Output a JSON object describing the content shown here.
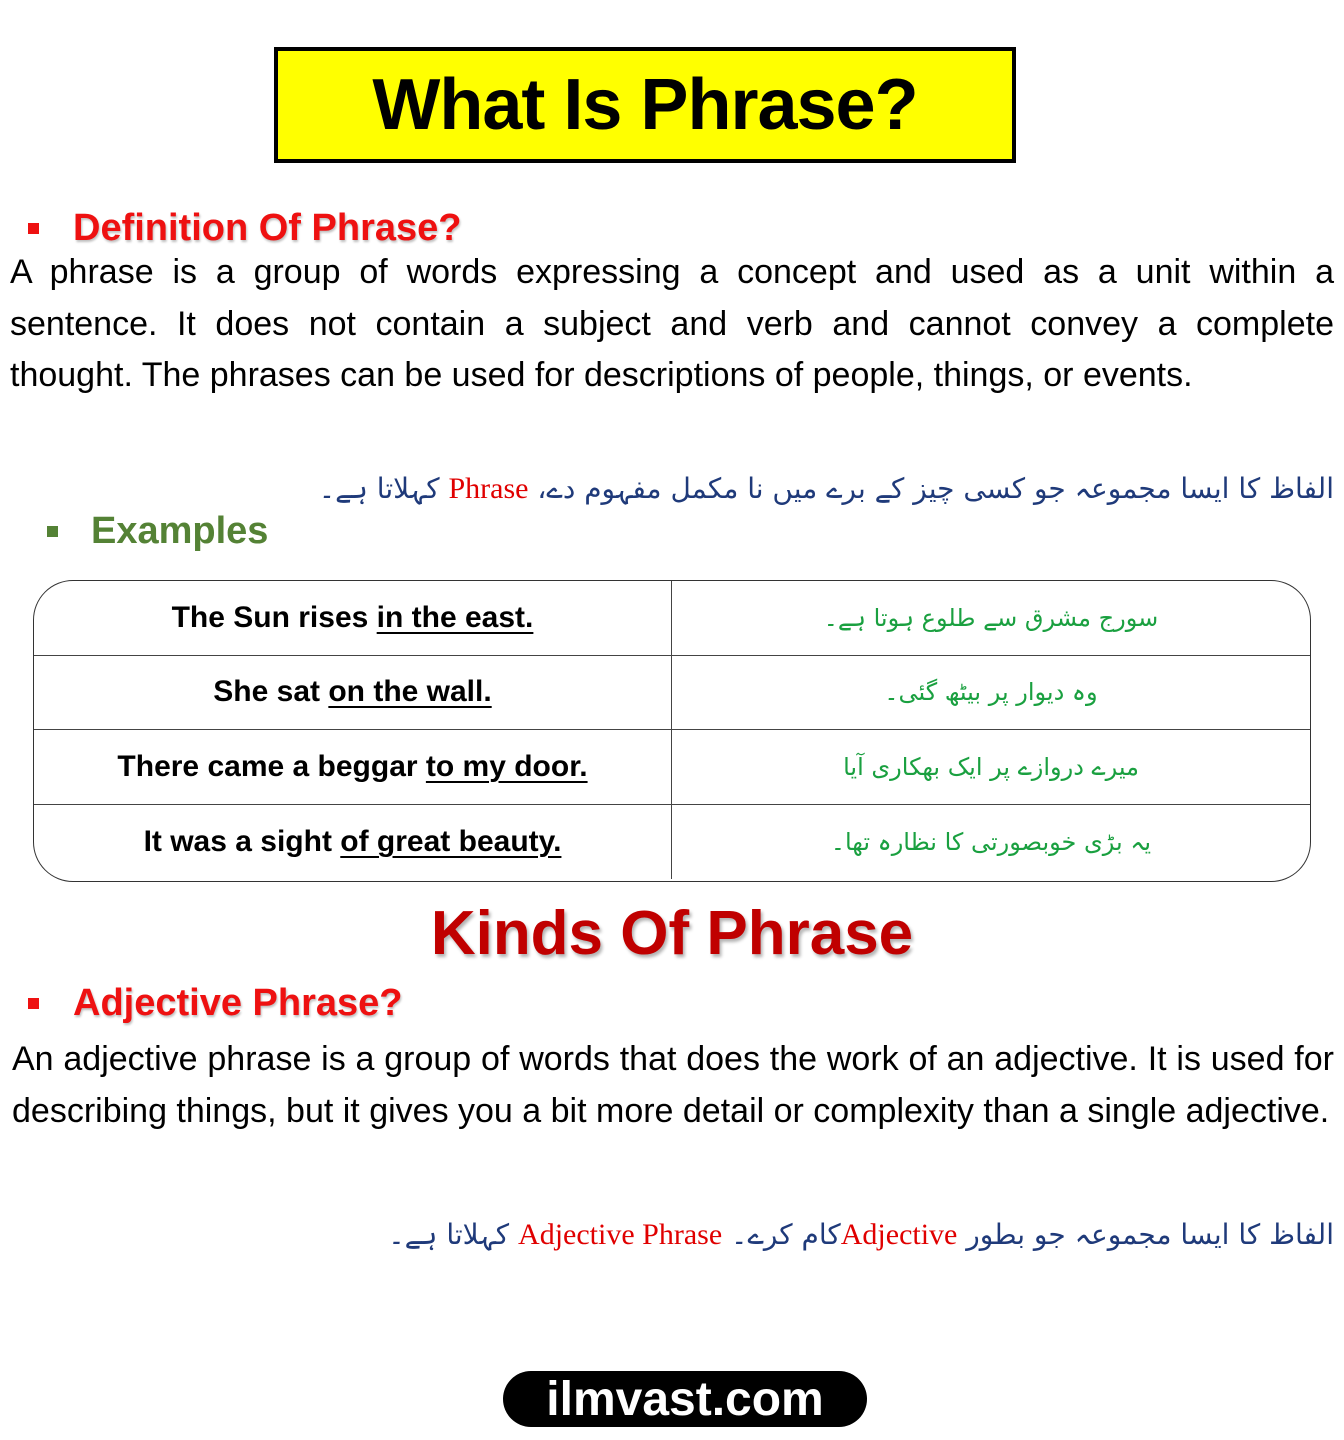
{
  "title": "What Is Phrase?",
  "definition": {
    "heading": "Definition Of Phrase?",
    "paragraph": "A phrase is a group of words expressing a concept and used as a unit within a sentence. It does not contain a subject and verb and cannot convey a complete thought. The phrases can be used for descriptions of people, things, or events.",
    "urdu_before": "الفاظ کا ایسا مجموعہ جو کسی چیز کے برے میں نا مکمل مفہوم دے،",
    "urdu_term": "Phrase",
    "urdu_after": "کہلاتا ہے۔"
  },
  "examples": {
    "heading": "Examples",
    "rows": [
      {
        "plain": "The Sun rises ",
        "underlined": "in the east.",
        "urdu": "سورج مشرق سے طلوع ہوتا ہے۔"
      },
      {
        "plain": "She sat ",
        "underlined": "on the wall.",
        "urdu": "وہ دیوار پر بیٹھ گئی۔"
      },
      {
        "plain": "There came a beggar ",
        "underlined": "to my door.",
        "urdu": "میرے دروازے پر ایک بھکاری آیا"
      },
      {
        "plain": "It was a sight ",
        "underlined": "of great beauty.",
        "urdu": "یہ بڑی خوبصورتی کا نظارہ تھا۔"
      }
    ]
  },
  "kinds_heading": "Kinds Of Phrase",
  "adjective": {
    "heading": "Adjective Phrase?",
    "paragraph": "An adjective phrase is a group of words that does the work of an adjective. It is used for describing things, but it gives you a bit more detail or complexity than a single adjective.",
    "urdu_part1": "الفاظ کا ایسا مجموعہ جو بطور",
    "urdu_term1": "Adjective",
    "urdu_part2": "کام کرے۔",
    "urdu_term2": "Adjective Phrase",
    "urdu_part3": "کہلاتا ہے۔"
  },
  "footer": "ilmvast.com",
  "colors": {
    "title_bg": "#ffff00",
    "heading_red": "#ee1111",
    "heading_green": "#548235",
    "kinds_red": "#c00000",
    "urdu_blue": "#1f3a7a",
    "urdu_green": "#1aa040"
  }
}
